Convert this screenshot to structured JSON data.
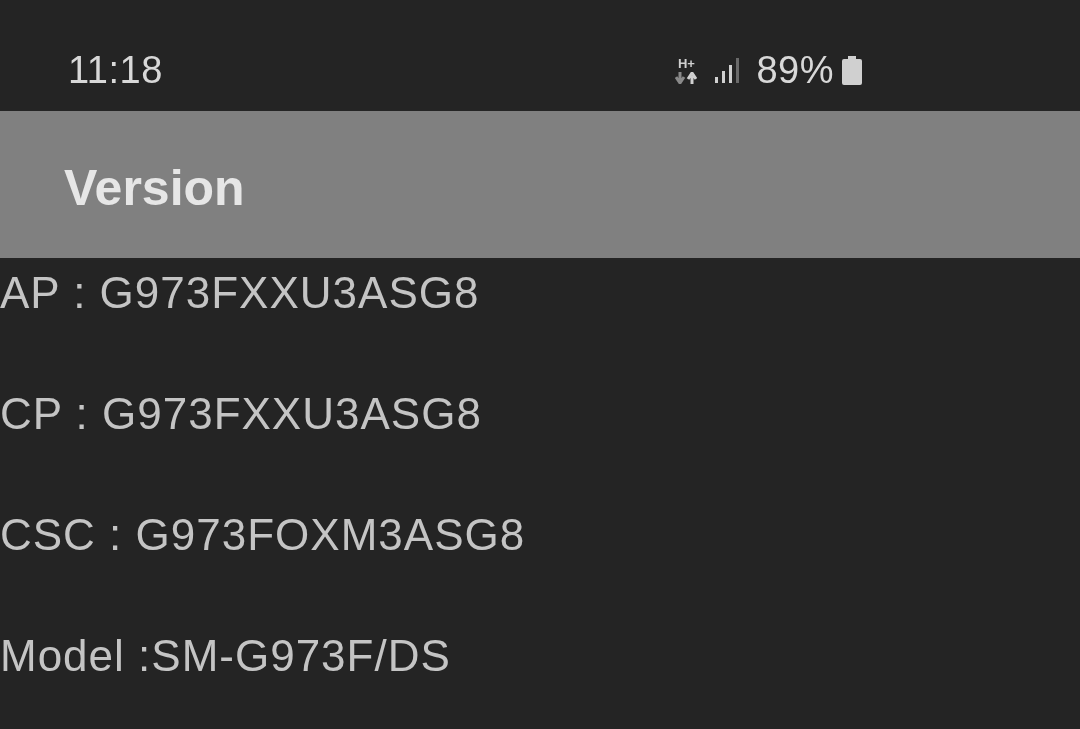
{
  "status_bar": {
    "time": "11:18",
    "network_type": "H+",
    "battery": "89%"
  },
  "header": {
    "title": "Version"
  },
  "items": [
    {
      "text": "AP : G973FXXU3ASG8"
    },
    {
      "text": "CP : G973FXXU3ASG8"
    },
    {
      "text": "CSC : G973FOXM3ASG8"
    },
    {
      "text": "Model :SM-G973F/DS"
    }
  ]
}
